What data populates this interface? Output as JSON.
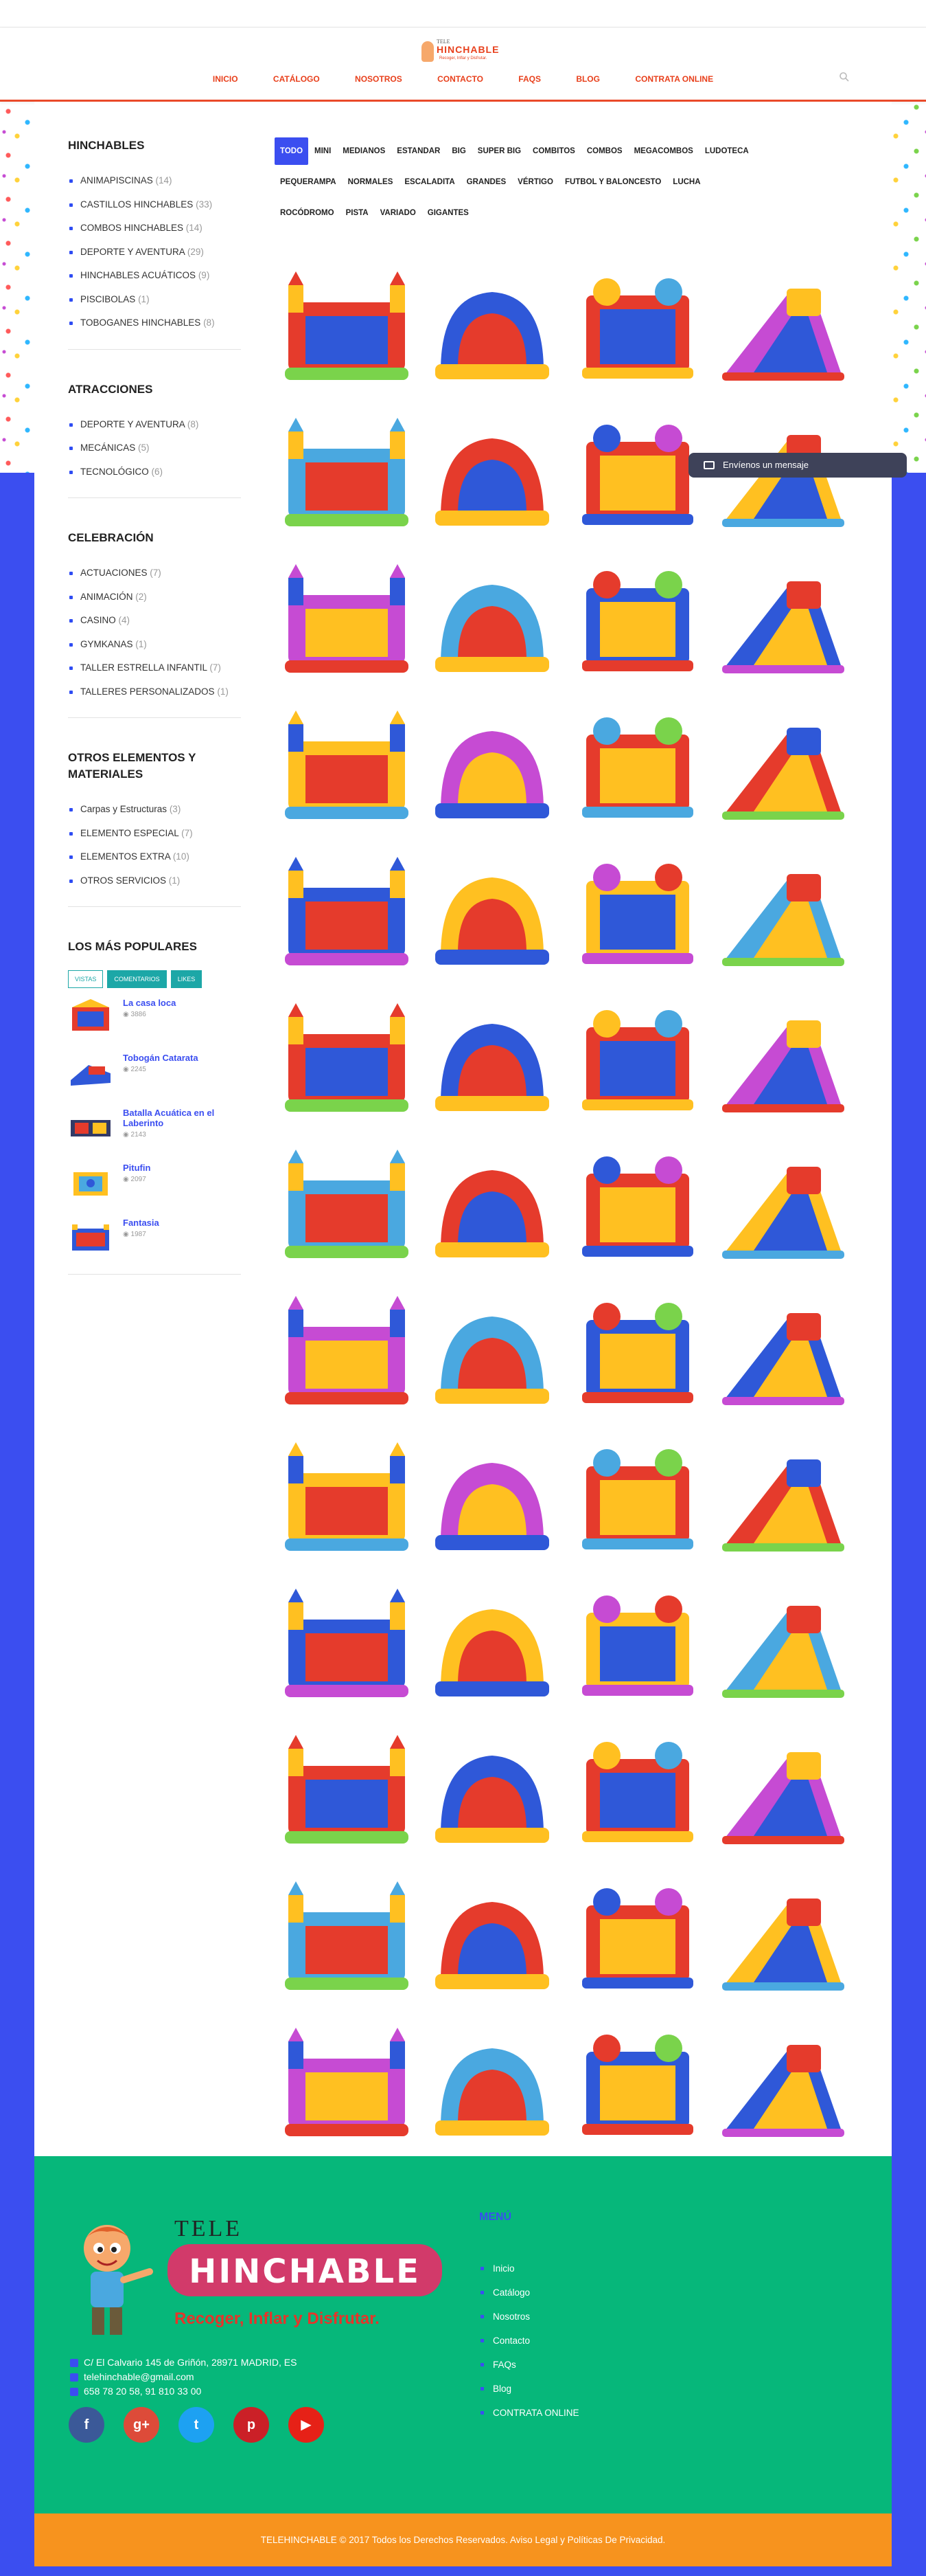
{
  "header": {
    "logo": {
      "line1": "TELE",
      "line2": "HINCHABLE",
      "tagline": "Recoger, Inflar y Disfrutar."
    },
    "nav": [
      "INICIO",
      "CATÁLOGO",
      "NOSOTROS",
      "CONTACTO",
      "FAQS",
      "BLOG",
      "CONTRATA ONLINE"
    ],
    "search_icon": "search-icon"
  },
  "sidebar": {
    "hinchables": {
      "title": "HINCHABLES",
      "items": [
        {
          "label": "ANIMAPISCINAS",
          "count": "(14)"
        },
        {
          "label": "CASTILLOS HINCHABLES",
          "count": "(33)"
        },
        {
          "label": "COMBOS HINCHABLES",
          "count": "(14)"
        },
        {
          "label": "DEPORTE Y AVENTURA",
          "count": "(29)"
        },
        {
          "label": "HINCHABLES ACUÁTICOS",
          "count": "(9)"
        },
        {
          "label": "PISCIBOLAS",
          "count": "(1)"
        },
        {
          "label": "TOBOGANES HINCHABLES",
          "count": "(8)"
        }
      ]
    },
    "atracciones": {
      "title": "ATRACCIONES",
      "items": [
        {
          "label": "DEPORTE Y AVENTURA",
          "count": "(8)"
        },
        {
          "label": "MECÁNICAS",
          "count": "(5)"
        },
        {
          "label": "TECNOLÓGICO",
          "count": "(6)"
        }
      ]
    },
    "celebracion": {
      "title": "CELEBRACIÓN",
      "items": [
        {
          "label": "ACTUACIONES",
          "count": "(7)"
        },
        {
          "label": "ANIMACIÓN",
          "count": "(2)"
        },
        {
          "label": "CASINO",
          "count": "(4)"
        },
        {
          "label": "GYMKANAS",
          "count": "(1)"
        },
        {
          "label": "TALLER ESTRELLA INFANTIL",
          "count": "(7)"
        },
        {
          "label": "TALLERES PERSONALIZADOS",
          "count": "(1)"
        }
      ]
    },
    "otros": {
      "title": "OTROS ELEMENTOS Y MATERIALES",
      "items": [
        {
          "label": "Carpas y Estructuras",
          "count": "(3)"
        },
        {
          "label": "ELEMENTO ESPECIAL",
          "count": "(7)"
        },
        {
          "label": "ELEMENTOS EXTRA",
          "count": "(10)"
        },
        {
          "label": "OTROS SERVICIOS",
          "count": "(1)"
        }
      ]
    },
    "populares": {
      "title": "LOS MÁS POPULARES",
      "tabs": [
        "VISTAS",
        "COMENTARIOS",
        "LIKES"
      ],
      "items": [
        {
          "title": "La casa loca",
          "views": "3886"
        },
        {
          "title": "Tobogán Catarata",
          "views": "2245"
        },
        {
          "title": "Batalla Acuática en el Laberinto",
          "views": "2143"
        },
        {
          "title": "Pitufin",
          "views": "2097"
        },
        {
          "title": "Fantasia",
          "views": "1987"
        }
      ]
    }
  },
  "filters": {
    "active": "TODO",
    "row1": [
      "TODO",
      "MINI",
      "MEDIANOS",
      "ESTANDAR",
      "BIG",
      "SUPER BIG",
      "COMBITOS",
      "COMBOS",
      "MEGACOMBOS",
      "LUDOTECA"
    ],
    "row2": [
      "PEQUERAMPA",
      "NORMALES",
      "ESCALADITA",
      "GRANDES",
      "VÉRTIGO",
      "FUTBOL Y BALONCESTO",
      "LUCHA"
    ],
    "row3": [
      "ROCÓDROMO",
      "PISTA",
      "VARIADO",
      "GIGANTES"
    ]
  },
  "chat": {
    "label": "Envíenos un mensaje"
  },
  "footer": {
    "address": "C/ El Calvario 145 de Griñón, 28971 MADRID, ES",
    "email": "telehinchable@gmail.com",
    "phone": "658 78 20 58, 91 810 33 00",
    "menu_title": "MENÚ",
    "menu": [
      "Inicio",
      "Catálogo",
      "Nosotros",
      "Contacto",
      "FAQs",
      "Blog",
      "CONTRATA ONLINE"
    ],
    "social": [
      "facebook-icon",
      "google-plus-icon",
      "twitter-icon",
      "pinterest-icon",
      "youtube-icon"
    ],
    "copyright": "TELEHINCHABLE © 2017 Todos los Derechos Reservados. Aviso Legal y Políticas De Privacidad."
  },
  "colors": {
    "accent": "#3b4ef0",
    "nav": "#e8401c",
    "footer": "#06b77a",
    "copyright": "#f7931e",
    "teal": "#1ca7a7"
  }
}
